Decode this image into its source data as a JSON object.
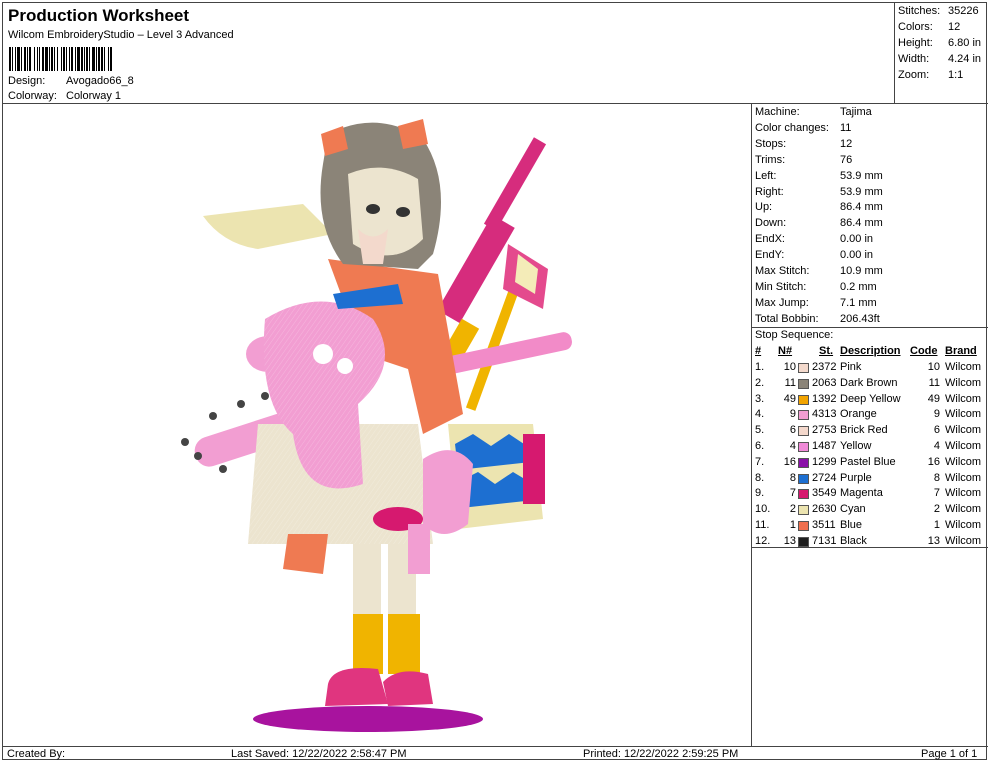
{
  "header": {
    "title": "Production Worksheet",
    "subtitle": "Wilcom EmbroideryStudio – Level 3 Advanced",
    "design_label": "Design:",
    "design_value": "Avogado66_8",
    "colorway_label": "Colorway:",
    "colorway_value": "Colorway 1"
  },
  "summary": [
    {
      "label": "Stitches:",
      "value": "35226"
    },
    {
      "label": "Colors:",
      "value": "12"
    },
    {
      "label": "Height:",
      "value": "6.80 in"
    },
    {
      "label": "Width:",
      "value": "4.24 in"
    },
    {
      "label": "Zoom:",
      "value": "1:1"
    }
  ],
  "machine_info": [
    {
      "label": "Machine:",
      "value": "Tajima"
    },
    {
      "label": "Color changes:",
      "value": "11"
    },
    {
      "label": "Stops:",
      "value": "12"
    },
    {
      "label": "Trims:",
      "value": "76"
    },
    {
      "label": "Left:",
      "value": "53.9 mm"
    },
    {
      "label": "Right:",
      "value": "53.9 mm"
    },
    {
      "label": "Up:",
      "value": "86.4 mm"
    },
    {
      "label": "Down:",
      "value": "86.4 mm"
    },
    {
      "label": "EndX:",
      "value": "0.00 in"
    },
    {
      "label": "EndY:",
      "value": "0.00 in"
    },
    {
      "label": "Max Stitch:",
      "value": "10.9 mm"
    },
    {
      "label": "Min Stitch:",
      "value": "0.2 mm"
    },
    {
      "label": "Max Jump:",
      "value": "7.1 mm"
    },
    {
      "label": "Total Bobbin:",
      "value": "206.43ft"
    }
  ],
  "stop_sequence": {
    "title": "Stop Sequence:",
    "headers": {
      "num": "#",
      "n": "N#",
      "st": "St.",
      "desc": "Description",
      "code": "Code",
      "brand": "Brand"
    },
    "rows": [
      {
        "num": "1.",
        "n": "10",
        "color": "#f3d9cc",
        "st": "2372",
        "desc": "Pink",
        "code": "10",
        "brand": "Wilcom"
      },
      {
        "num": "2.",
        "n": "11",
        "color": "#8b8478",
        "st": "2063",
        "desc": "Dark Brown",
        "code": "11",
        "brand": "Wilcom"
      },
      {
        "num": "3.",
        "n": "49",
        "color": "#f2a400",
        "st": "1392",
        "desc": "Deep Yellow",
        "code": "49",
        "brand": "Wilcom"
      },
      {
        "num": "4.",
        "n": "9",
        "color": "#f29ed2",
        "st": "4313",
        "desc": "Orange",
        "code": "9",
        "brand": "Wilcom"
      },
      {
        "num": "5.",
        "n": "6",
        "color": "#f4d8cc",
        "st": "2753",
        "desc": "Brick Red",
        "code": "6",
        "brand": "Wilcom"
      },
      {
        "num": "6.",
        "n": "4",
        "color": "#f08ad8",
        "st": "1487",
        "desc": "Yellow",
        "code": "4",
        "brand": "Wilcom"
      },
      {
        "num": "7.",
        "n": "16",
        "color": "#8a0fa8",
        "st": "1299",
        "desc": "Pastel Blue",
        "code": "16",
        "brand": "Wilcom"
      },
      {
        "num": "8.",
        "n": "8",
        "color": "#1d6fd1",
        "st": "2724",
        "desc": "Purple",
        "code": "8",
        "brand": "Wilcom"
      },
      {
        "num": "9.",
        "n": "7",
        "color": "#d6196f",
        "st": "3549",
        "desc": "Magenta",
        "code": "7",
        "brand": "Wilcom"
      },
      {
        "num": "10.",
        "n": "2",
        "color": "#ece4b0",
        "st": "2630",
        "desc": "Cyan",
        "code": "2",
        "brand": "Wilcom"
      },
      {
        "num": "11.",
        "n": "1",
        "color": "#ef6f4e",
        "st": "3511",
        "desc": "Blue",
        "code": "1",
        "brand": "Wilcom"
      },
      {
        "num": "12.",
        "n": "13",
        "color": "#1e1e1e",
        "st": "7131",
        "desc": "Black",
        "code": "13",
        "brand": "Wilcom"
      }
    ]
  },
  "footer": {
    "created_by": "Created By:",
    "last_saved": "Last Saved: 12/22/2022 2:58:47 PM",
    "printed": "Printed: 12/22/2022 2:59:25 PM",
    "page": "Page 1 of 1"
  }
}
